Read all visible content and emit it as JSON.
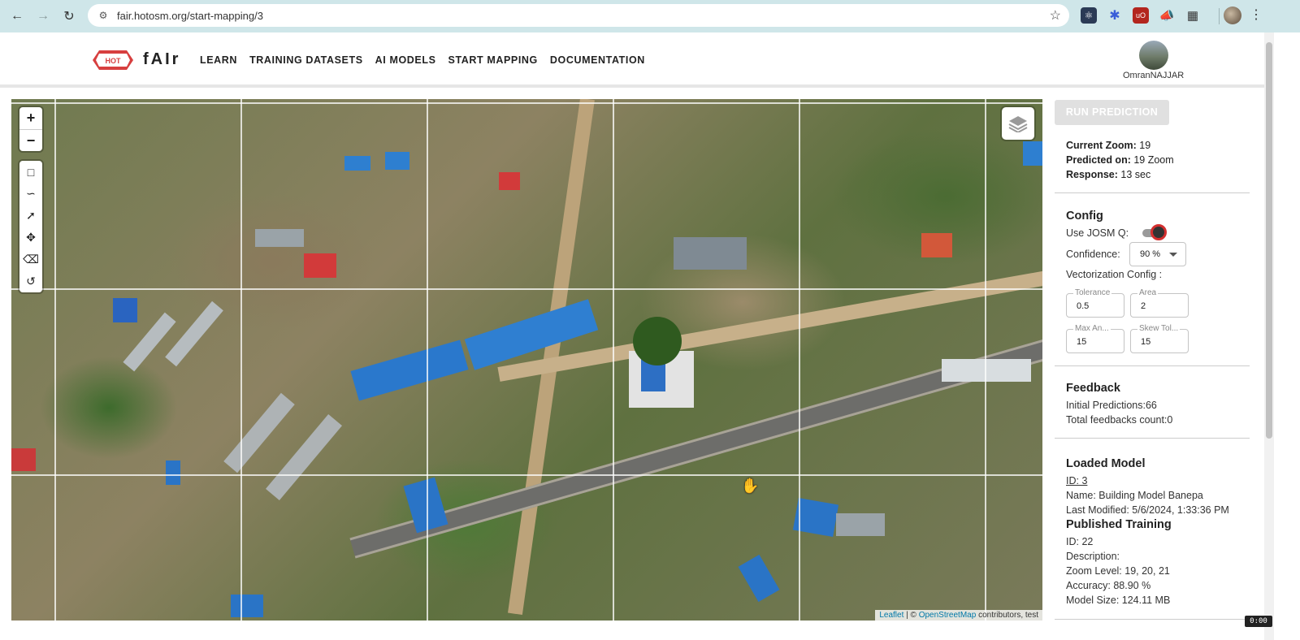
{
  "browser": {
    "url": "fair.hotosm.org/start-mapping/3"
  },
  "header": {
    "logo_badge": "HOT",
    "logo_text": "fAIr",
    "nav": [
      "LEARN",
      "TRAINING DATASETS",
      "AI MODELS",
      "START MAPPING",
      "DOCUMENTATION"
    ],
    "user_name": "OmranNAJJAR"
  },
  "map": {
    "zoom_in": "+",
    "zoom_out": "−",
    "attribution_leaflet": "Leaflet",
    "attribution_sep": " | © ",
    "attribution_osm": "OpenStreetMap",
    "attribution_rest": " contributors, test"
  },
  "panel": {
    "run_button": "RUN PREDICTION",
    "current_zoom_label": "Current Zoom:",
    "current_zoom_value": " 19",
    "predicted_on_label": "Predicted on:",
    "predicted_on_value": " 19 Zoom",
    "response_label": "Response:",
    "response_value": " 13 sec",
    "config_title": "Config",
    "use_josm_label": "Use JOSM Q:",
    "confidence_label": "Confidence:",
    "confidence_value": "90 %",
    "vectorization_label": "Vectorization Config :",
    "tolerance_label": "Tolerance",
    "tolerance_value": "0.5",
    "area_label": "Area",
    "area_value": "2",
    "max_angle_label": "Max An...",
    "max_angle_value": "15",
    "skew_label": "Skew Tol...",
    "skew_value": "15",
    "feedback_title": "Feedback",
    "initial_predictions": "Initial Predictions:66",
    "total_feedbacks": "Total feedbacks count:0",
    "loaded_model_title": "Loaded Model",
    "model_id": "ID: 3",
    "model_name": "Name: Building Model Banepa",
    "model_modified": "Last Modified: 5/6/2024, 1:33:36 PM",
    "published_title": "Published Training",
    "training_id": "ID: 22",
    "training_description": "Description:",
    "training_zoom": "Zoom Level: 19, 20, 21",
    "training_accuracy": "Accuracy: 88.90 %",
    "training_size": "Model Size: 124.11 MB"
  },
  "colors": {
    "chrome_bg": "#cfe6e9",
    "brand_red": "#d73f3f",
    "toggle_ring": "#d32f2f",
    "disabled_button": "#e0e0e0"
  }
}
